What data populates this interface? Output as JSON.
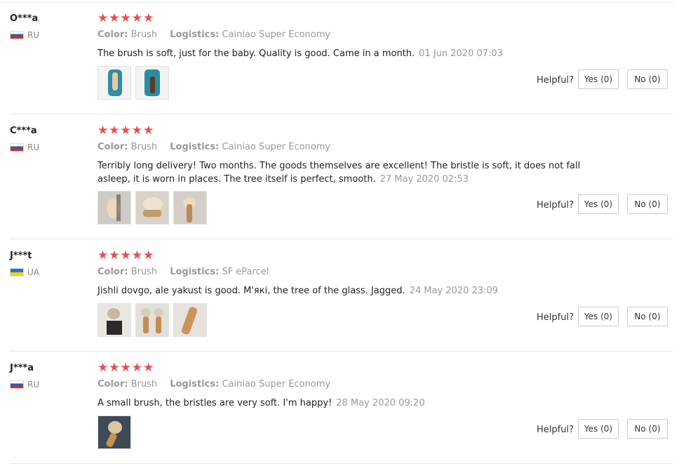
{
  "reviews": [
    {
      "user": "O***a",
      "country": "RU",
      "stars": "★★★★★",
      "color_label": "Color:",
      "color_value": "Brush",
      "logistics_label": "Logistics:",
      "logistics_value": "Cainiao Super Economy",
      "text": "The brush is soft, just for the baby. Quality is good. Came in a month.",
      "date": "01 Jun 2020 07:03",
      "photos": 2,
      "helpful_label": "Helpful?",
      "yes_label": "Yes (0)",
      "no_label": "No (0)"
    },
    {
      "user": "C***a",
      "country": "RU",
      "stars": "★★★★★",
      "color_label": "Color:",
      "color_value": "Brush",
      "logistics_label": "Logistics:",
      "logistics_value": "Cainiao Super Economy",
      "text": "Terribly long delivery! Two months. The goods themselves are excellent! The bristle is soft, it does not fall asleep, it is worn in places. The tree itself is perfect, smooth.",
      "date": "27 May 2020 02:53",
      "photos": 3,
      "helpful_label": "Helpful?",
      "yes_label": "Yes (0)",
      "no_label": "No (0)"
    },
    {
      "user": "J***t",
      "country": "UA",
      "stars": "★★★★★",
      "color_label": "Color:",
      "color_value": "Brush",
      "logistics_label": "Logistics:",
      "logistics_value": "SF eParcel",
      "text": "Jishli dovgo, ale yakust is good. M'які, the tree of the glass. Jagged.",
      "date": "24 May 2020 23:09",
      "photos": 3,
      "helpful_label": "Helpful?",
      "yes_label": "Yes (0)",
      "no_label": "No (0)"
    },
    {
      "user": "J***a",
      "country": "RU",
      "stars": "★★★★★",
      "color_label": "Color:",
      "color_value": "Brush",
      "logistics_label": "Logistics:",
      "logistics_value": "Cainiao Super Economy",
      "text": "A small brush, the bristles are very soft. I'm happy!",
      "date": "28 May 2020 09:20",
      "photos": 1,
      "helpful_label": "Helpful?",
      "yes_label": "Yes (0)",
      "no_label": "No (0)"
    }
  ],
  "colors": {
    "star": "#f04a4a",
    "muted": "#999999",
    "separator": "#e8e8e8"
  }
}
